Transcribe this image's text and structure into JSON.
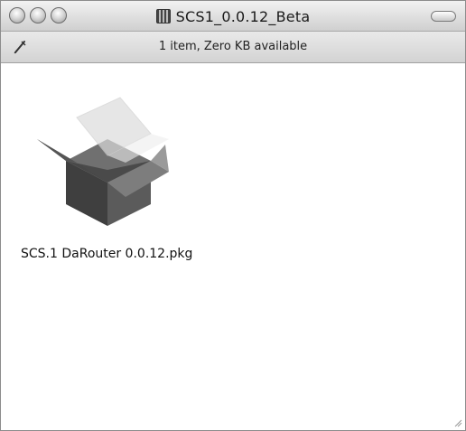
{
  "window": {
    "title": "SCS1_0.0.12_Beta",
    "title_icon": "disk-image-icon"
  },
  "statusbar": {
    "text": "1 item, Zero KB available",
    "icon": "pencil-icon"
  },
  "items": [
    {
      "label": "SCS.1 DaRouter 0.0.12.pkg",
      "icon": "package-icon"
    }
  ]
}
